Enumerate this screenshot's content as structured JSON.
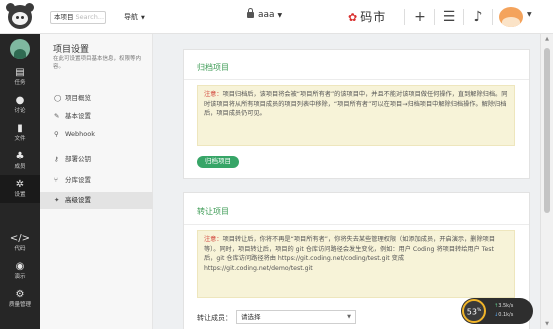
{
  "topbar": {
    "scope_label": "本项目",
    "search_placeholder": "Search...",
    "nav_label": "导航",
    "project_name": "aaa",
    "brand": "码市"
  },
  "sidebar": {
    "items": [
      {
        "label": "任务",
        "icon": "task-icon"
      },
      {
        "label": "讨论",
        "icon": "discussion-icon"
      },
      {
        "label": "文件",
        "icon": "file-icon"
      },
      {
        "label": "成员",
        "icon": "members-icon"
      },
      {
        "label": "设置",
        "icon": "settings-icon"
      },
      {
        "label": "代码",
        "icon": "code-icon"
      },
      {
        "label": "演示",
        "icon": "demo-icon"
      },
      {
        "label": "质量管理",
        "icon": "quality-icon"
      }
    ]
  },
  "submenu": {
    "title": "项目设置",
    "desc": "在此可设置项目基本信息，权限等内容。",
    "items": [
      {
        "label": "项目概览",
        "icon": "overview-icon"
      },
      {
        "label": "基本设置",
        "icon": "wrench-icon"
      },
      {
        "label": "Webhook",
        "icon": "webhook-icon"
      },
      {
        "label": "部署公钥",
        "icon": "key-icon"
      },
      {
        "label": "分库设置",
        "icon": "branch-icon"
      },
      {
        "label": "高级设置",
        "icon": "advanced-icon"
      }
    ]
  },
  "archive": {
    "title": "归档项目",
    "notice_prefix": "注意：",
    "notice": "项目归档后，该项目将会被“项目所有者”的该项目中，并且不能对该项目做任何操作，直到解除归档。同时该项目将从所有项目成员的项目列表中移除，“项目所有者”可以在项目→归档项目中解除归档操作。解除归档后，项目成员仍可见。",
    "button": "归档项目"
  },
  "transfer": {
    "title": "转让项目",
    "notice_prefix": "注意：",
    "notice": "项目转让后，你将不再是“项目所有者”，你将失去某些管理权限（如添加成员，开启演示，删除项目等）。同时，项目转让后，项目的 git 仓库访问路径会发生变化，例如：用户 Coding 将项目转给用户 Test 后，git 仓库访问路径将由 https://git.coding.net/coding/test.git 变成 https://git.coding.net/demo/test.git",
    "field_label": "转让成员：",
    "select_value": "请选择"
  },
  "widget": {
    "value": "53",
    "unit": "%",
    "up": "3.5k/s",
    "down": "0.1k/s"
  }
}
